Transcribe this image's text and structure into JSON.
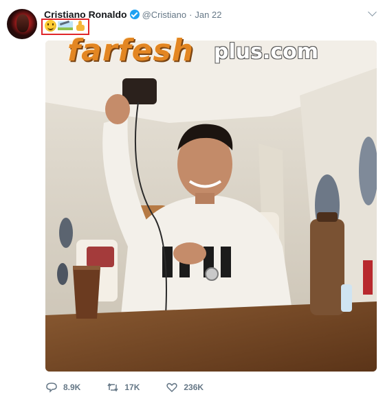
{
  "tweet": {
    "author_name": "Cristiano Ronaldo",
    "handle": "@Cristiano",
    "separator": "·",
    "date": "Jan 22",
    "emoji": [
      "smiling-face-emoji",
      "airplane-emoji",
      "thumbs-up-emoji"
    ],
    "watermark": {
      "main": "farfesh",
      "sub": "plus.com"
    },
    "actions": {
      "replies": "8.9K",
      "retweets": "17K",
      "likes": "236K"
    },
    "colors": {
      "verified": "#1da1f2",
      "highlight_box": "#e0262a",
      "secondary_text": "#657786"
    }
  }
}
